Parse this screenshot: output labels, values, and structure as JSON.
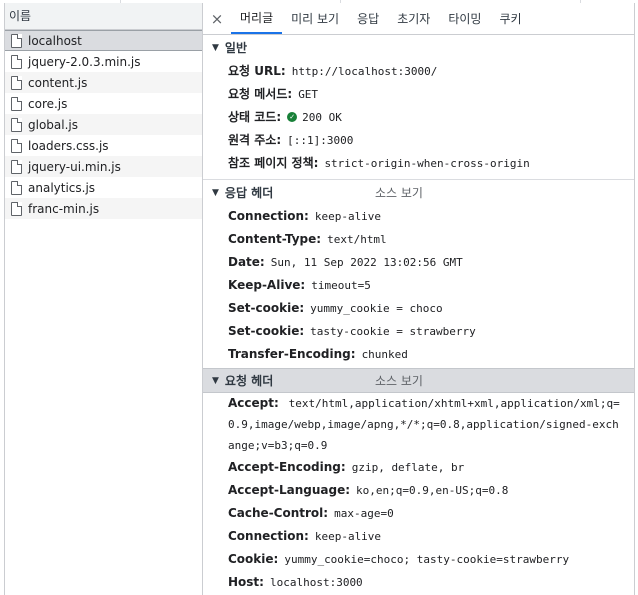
{
  "left_panel": {
    "header": "이름",
    "files": [
      {
        "name": "localhost",
        "selected": true
      },
      {
        "name": "jquery-2.0.3.min.js"
      },
      {
        "name": "content.js"
      },
      {
        "name": "core.js"
      },
      {
        "name": "global.js"
      },
      {
        "name": "loaders.css.js"
      },
      {
        "name": "jquery-ui.min.js"
      },
      {
        "name": "analytics.js"
      },
      {
        "name": "franc-min.js"
      }
    ]
  },
  "tabs": {
    "close_glyph": "×",
    "items": [
      "머리글",
      "미리 보기",
      "응답",
      "초기자",
      "타이밍",
      "쿠키"
    ],
    "active": "머리글"
  },
  "general": {
    "title": "일반",
    "rows": [
      {
        "key": "요청 URL:",
        "value": "http://localhost:3000/"
      },
      {
        "key": "요청 메서드:",
        "value": "GET"
      },
      {
        "key": "상태 코드:",
        "value": "200 OK"
      },
      {
        "key": "원격 주소:",
        "value": "[::1]:3000"
      },
      {
        "key": "참조 페이지 정책:",
        "value": "strict-origin-when-cross-origin"
      }
    ]
  },
  "response_headers": {
    "title": "응답 헤더",
    "view_source": "소스 보기",
    "rows": [
      {
        "key": "Connection:",
        "value": "keep-alive"
      },
      {
        "key": "Content-Type:",
        "value": "text/html"
      },
      {
        "key": "Date:",
        "value": "Sun, 11 Sep 2022 13:02:56 GMT"
      },
      {
        "key": "Keep-Alive:",
        "value": "timeout=5"
      },
      {
        "key": "Set-cookie:",
        "value": "yummy_cookie = choco"
      },
      {
        "key": "Set-cookie:",
        "value": "tasty-cookie = strawberry"
      },
      {
        "key": "Transfer-Encoding:",
        "value": "chunked"
      }
    ]
  },
  "request_headers": {
    "title": "요청 헤더",
    "view_source": "소스 보기",
    "rows": [
      {
        "key": "Accept:",
        "value": "text/html,application/xhtml+xml,application/xml;q=0.9,image/webp,image/apng,*/*;q=0.8,application/signed-exchange;v=b3;q=0.9"
      },
      {
        "key": "Accept-Encoding:",
        "value": "gzip, deflate, br"
      },
      {
        "key": "Accept-Language:",
        "value": "ko,en;q=0.9,en-US;q=0.8"
      },
      {
        "key": "Cache-Control:",
        "value": "max-age=0"
      },
      {
        "key": "Connection:",
        "value": "keep-alive"
      },
      {
        "key": "Cookie:",
        "value": "yummy_cookie=choco; tasty-cookie=strawberry"
      },
      {
        "key": "Host:",
        "value": "localhost:3000"
      }
    ]
  },
  "colors": {
    "status_ok": "#188038",
    "active_tab": "#1a73e8",
    "selected_row": "#dadce0"
  }
}
